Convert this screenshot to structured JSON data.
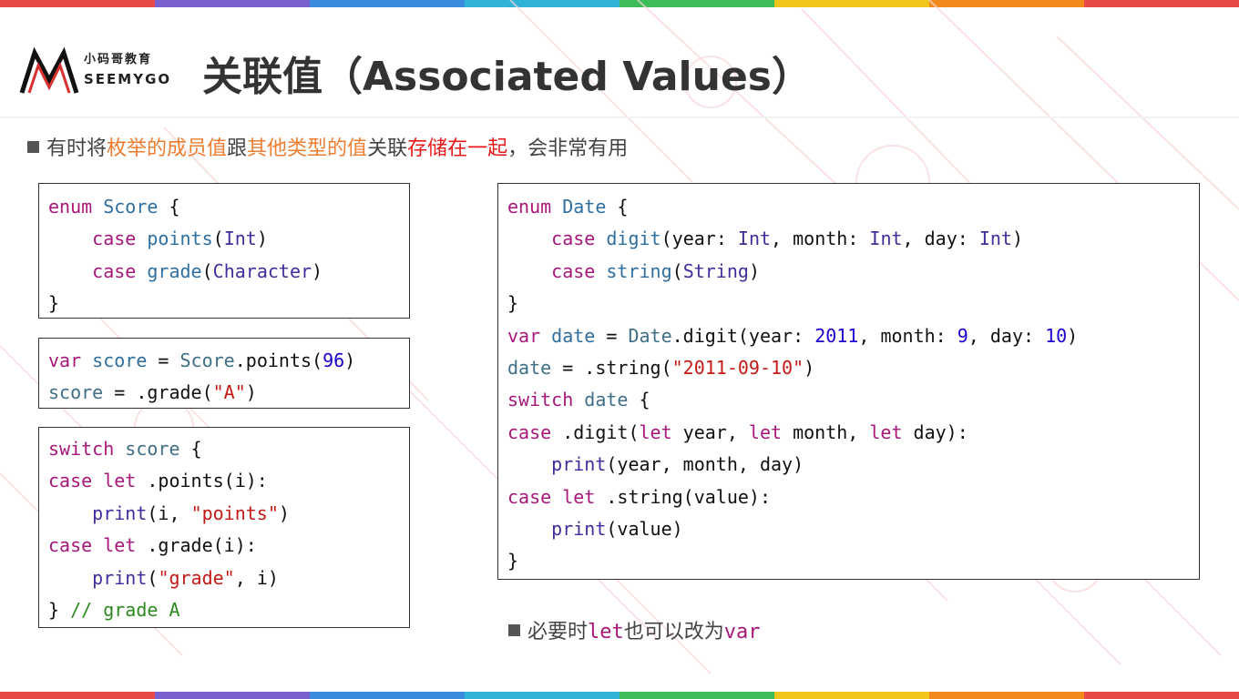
{
  "header": {
    "logo_cn": "小码哥教育",
    "logo_en": "SEEMYGO",
    "title": "关联值（Associated Values）"
  },
  "intro": {
    "segments": [
      {
        "text": "有时将",
        "color": "#444444"
      },
      {
        "text": "枚举的成员值",
        "color": "#ed7d31"
      },
      {
        "text": "跟",
        "color": "#444444"
      },
      {
        "text": "其他类型的值",
        "color": "#ed7d31"
      },
      {
        "text": "关联",
        "color": "#444444"
      },
      {
        "text": "存储在一起",
        "color": "#e8191b"
      },
      {
        "text": "，会非常有用",
        "color": "#444444"
      }
    ]
  },
  "note": {
    "p1": "必要时",
    "kw1": "let",
    "p2": "也可以改为",
    "kw2": "var"
  },
  "code_blocks": [
    {
      "name": "enum-score",
      "lines": [
        [
          [
            "kw",
            "enum"
          ],
          [
            "pl",
            " "
          ],
          [
            "ty",
            "Score"
          ],
          [
            "pl",
            " {"
          ]
        ],
        [
          [
            "pl",
            "    "
          ],
          [
            "kw",
            "case"
          ],
          [
            "pl",
            " "
          ],
          [
            "ty",
            "points"
          ],
          [
            "pl",
            "("
          ],
          [
            "fn",
            "Int"
          ],
          [
            "pl",
            ")"
          ]
        ],
        [
          [
            "pl",
            "    "
          ],
          [
            "kw",
            "case"
          ],
          [
            "pl",
            " "
          ],
          [
            "ty",
            "grade"
          ],
          [
            "pl",
            "("
          ],
          [
            "fn",
            "Character"
          ],
          [
            "pl",
            ")"
          ]
        ],
        [
          [
            "pl",
            "}"
          ]
        ]
      ]
    },
    {
      "name": "var-score",
      "lines": [
        [
          [
            "kw",
            "var"
          ],
          [
            "pl",
            " "
          ],
          [
            "ty",
            "score"
          ],
          [
            "pl",
            " = "
          ],
          [
            "var",
            "Score"
          ],
          [
            "pl",
            ".points("
          ],
          [
            "num",
            "96"
          ],
          [
            "pl",
            ")"
          ]
        ],
        [
          [
            "var",
            "score"
          ],
          [
            "pl",
            " = .grade("
          ],
          [
            "str",
            "\"A\""
          ],
          [
            "pl",
            ")"
          ]
        ]
      ]
    },
    {
      "name": "switch-score",
      "lines": [
        [
          [
            "kw",
            "switch"
          ],
          [
            "pl",
            " "
          ],
          [
            "var",
            "score"
          ],
          [
            "pl",
            " {"
          ]
        ],
        [
          [
            "kw",
            "case"
          ],
          [
            "pl",
            " "
          ],
          [
            "kw",
            "let"
          ],
          [
            "pl",
            " .points(i):"
          ]
        ],
        [
          [
            "pl",
            "    "
          ],
          [
            "fn",
            "print"
          ],
          [
            "pl",
            "(i, "
          ],
          [
            "str",
            "\"points\""
          ],
          [
            "pl",
            ")"
          ]
        ],
        [
          [
            "kw",
            "case"
          ],
          [
            "pl",
            " "
          ],
          [
            "kw",
            "let"
          ],
          [
            "pl",
            " .grade(i):"
          ]
        ],
        [
          [
            "pl",
            "    "
          ],
          [
            "fn",
            "print"
          ],
          [
            "pl",
            "("
          ],
          [
            "str",
            "\"grade\""
          ],
          [
            "pl",
            ", i)"
          ]
        ],
        [
          [
            "pl",
            "} "
          ],
          [
            "cm",
            "// grade A"
          ]
        ]
      ]
    },
    {
      "name": "enum-date",
      "lines": [
        [
          [
            "kw",
            "enum"
          ],
          [
            "pl",
            " "
          ],
          [
            "ty",
            "Date"
          ],
          [
            "pl",
            " {"
          ]
        ],
        [
          [
            "pl",
            "    "
          ],
          [
            "kw",
            "case"
          ],
          [
            "pl",
            " "
          ],
          [
            "ty",
            "digit"
          ],
          [
            "pl",
            "(year: "
          ],
          [
            "fn",
            "Int"
          ],
          [
            "pl",
            ", month: "
          ],
          [
            "fn",
            "Int"
          ],
          [
            "pl",
            ", day: "
          ],
          [
            "fn",
            "Int"
          ],
          [
            "pl",
            ")"
          ]
        ],
        [
          [
            "pl",
            "    "
          ],
          [
            "kw",
            "case"
          ],
          [
            "pl",
            " "
          ],
          [
            "ty",
            "string"
          ],
          [
            "pl",
            "("
          ],
          [
            "fn",
            "String"
          ],
          [
            "pl",
            ")"
          ]
        ],
        [
          [
            "pl",
            "}"
          ]
        ],
        [
          [
            "kw",
            "var"
          ],
          [
            "pl",
            " "
          ],
          [
            "ty",
            "date"
          ],
          [
            "pl",
            " = "
          ],
          [
            "var",
            "Date"
          ],
          [
            "pl",
            ".digit(year: "
          ],
          [
            "num",
            "2011"
          ],
          [
            "pl",
            ", month: "
          ],
          [
            "num",
            "9"
          ],
          [
            "pl",
            ", day: "
          ],
          [
            "num",
            "10"
          ],
          [
            "pl",
            ")"
          ]
        ],
        [
          [
            "var",
            "date"
          ],
          [
            "pl",
            " = .string("
          ],
          [
            "str",
            "\"2011-09-10\""
          ],
          [
            "pl",
            ")"
          ]
        ],
        [
          [
            "kw",
            "switch"
          ],
          [
            "pl",
            " "
          ],
          [
            "var",
            "date"
          ],
          [
            "pl",
            " {"
          ]
        ],
        [
          [
            "kw",
            "case"
          ],
          [
            "pl",
            " .digit("
          ],
          [
            "kw",
            "let"
          ],
          [
            "pl",
            " year, "
          ],
          [
            "kw",
            "let"
          ],
          [
            "pl",
            " month, "
          ],
          [
            "kw",
            "let"
          ],
          [
            "pl",
            " day):"
          ]
        ],
        [
          [
            "pl",
            "    "
          ],
          [
            "fn",
            "print"
          ],
          [
            "pl",
            "(year, month, day)"
          ]
        ],
        [
          [
            "kw",
            "case"
          ],
          [
            "pl",
            " "
          ],
          [
            "kw",
            "let"
          ],
          [
            "pl",
            " .string(value):"
          ]
        ],
        [
          [
            "pl",
            "    "
          ],
          [
            "fn",
            "print"
          ],
          [
            "pl",
            "(value)"
          ]
        ],
        [
          [
            "pl",
            "}"
          ]
        ]
      ]
    }
  ]
}
